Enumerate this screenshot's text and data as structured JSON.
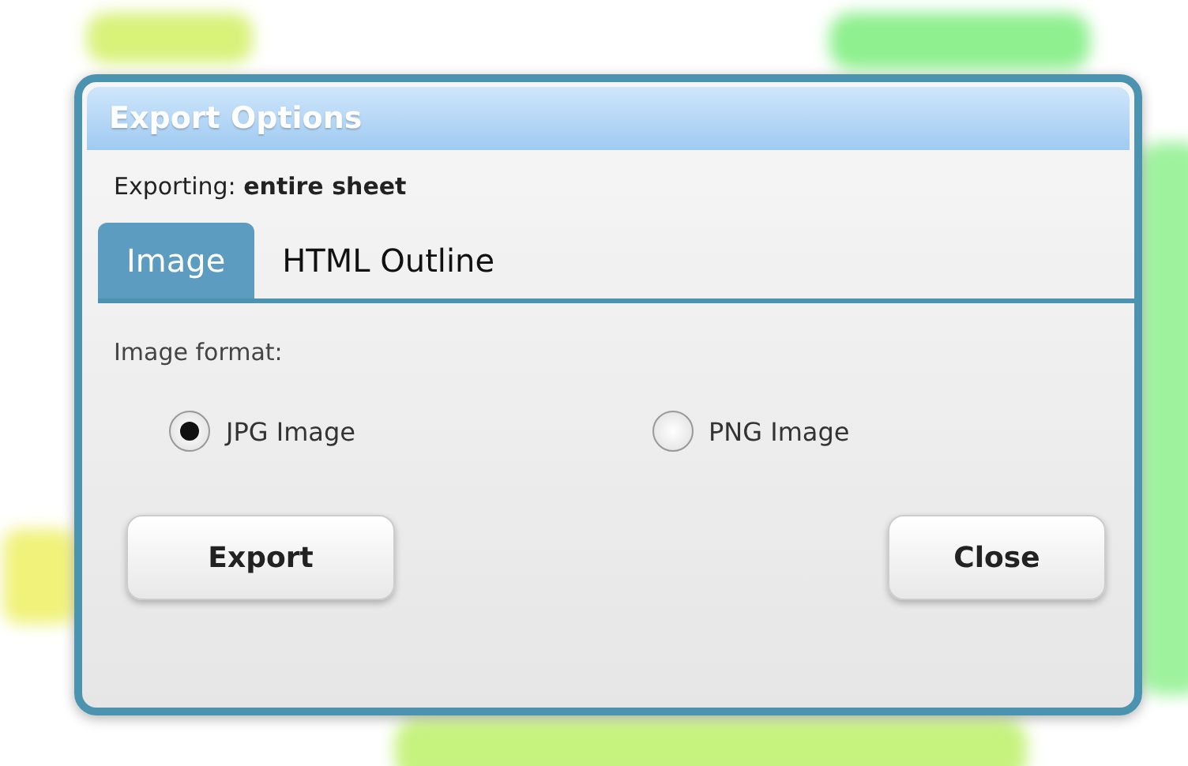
{
  "window": {
    "title": "Export Options"
  },
  "exporting": "Exporting: **entire sheet**",
  "tabs": [
    {
      "label": "Image",
      "selected": true
    },
    {
      "label": "HTML Outline",
      "selected": false
    }
  ],
  "format_label": "Image format:",
  "options": [
    {
      "label": "JPG Image",
      "selected": true
    },
    {
      "label": "PNG Image",
      "selected": false
    }
  ],
  "buttons": [
    "Export",
    "Close"
  ]
}
